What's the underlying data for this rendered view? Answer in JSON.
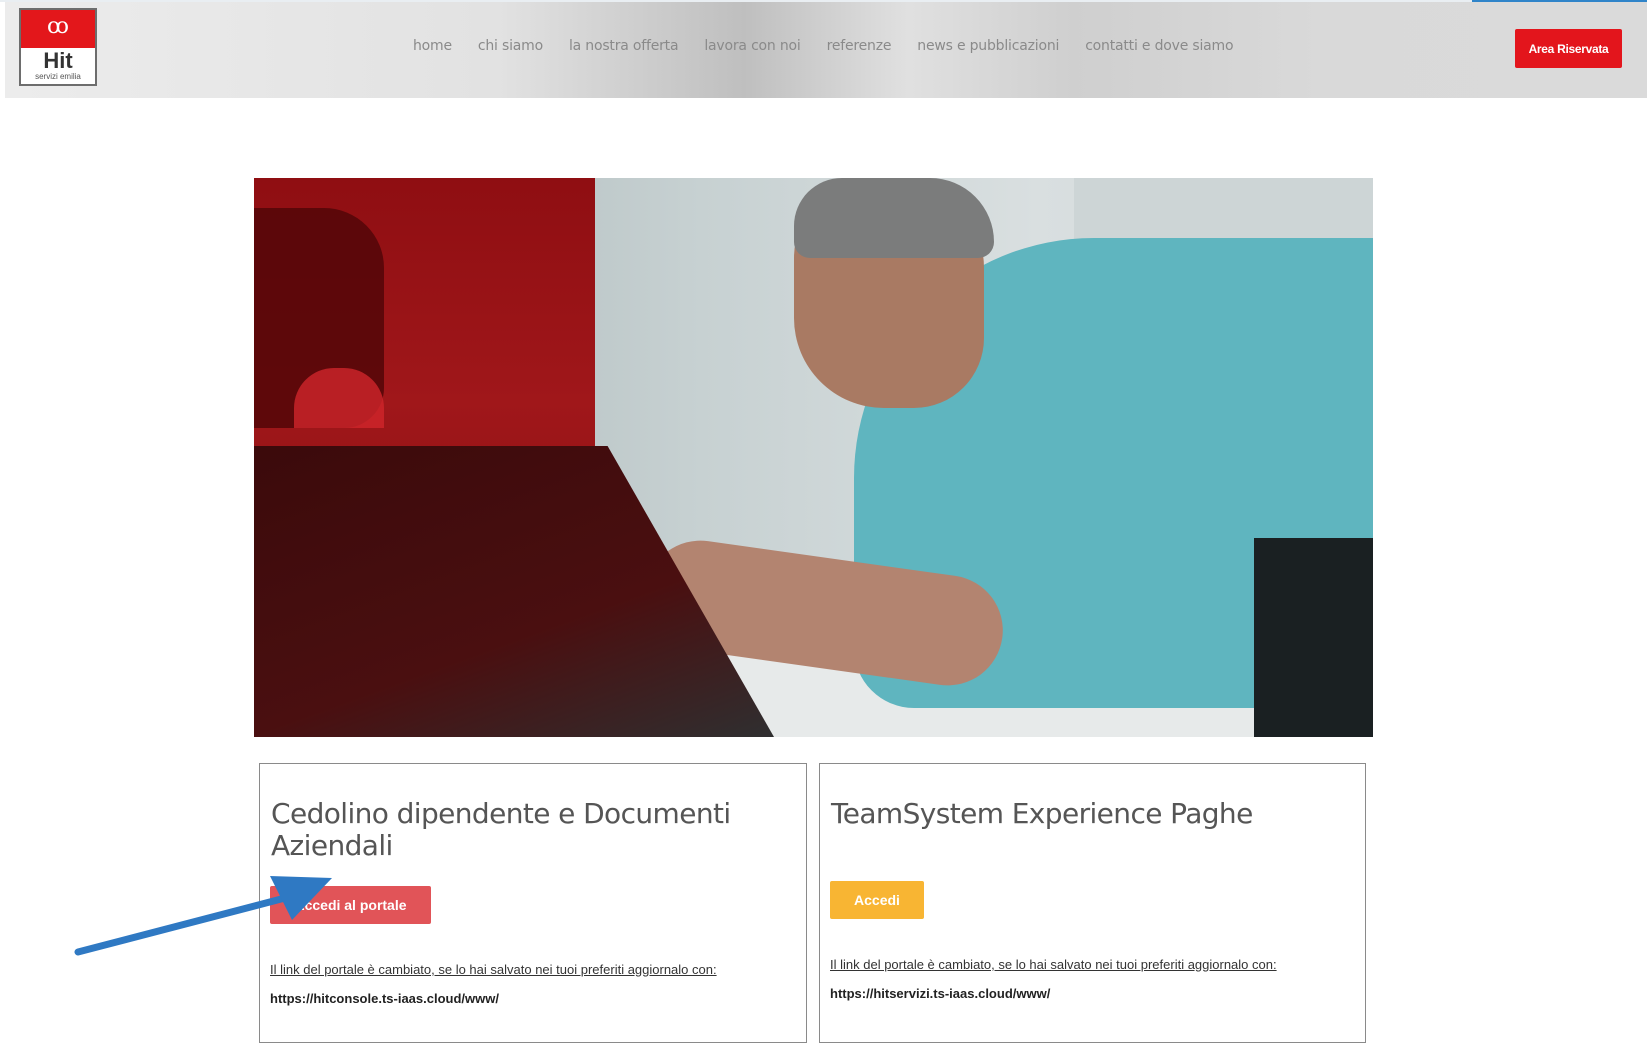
{
  "brand": {
    "logo_name": "Hit",
    "logo_sub": "servizi emilia",
    "logo_glyph": "ꝏ"
  },
  "nav": {
    "items": [
      {
        "label": "home"
      },
      {
        "label": "chi siamo"
      },
      {
        "label": "la nostra offerta"
      },
      {
        "label": "lavora con noi"
      },
      {
        "label": "referenze"
      },
      {
        "label": "news e pubblicazioni"
      },
      {
        "label": "contatti e dove siamo"
      }
    ],
    "area_button": "Area Riservata"
  },
  "colors": {
    "brand_red": "#e3151c",
    "button_red": "#e15458",
    "button_yellow": "#f8b533",
    "annotation_blue": "#2f79c3"
  },
  "cards": [
    {
      "title": "Cedolino dipendente e Documenti Aziendali",
      "button_label": "Accedi al portale",
      "note_text": "Il link del portale è cambiato, se lo hai salvato nei tuoi preferiti aggiornalo con: ",
      "note_url": "https://hitconsole.ts-iaas.cloud/www/"
    },
    {
      "title": "TeamSystem Experience Paghe",
      "button_label": "Accedi",
      "note_text": "Il link del portale è cambiato, se lo hai salvato nei tuoi preferiti aggiornalo con: ",
      "note_url": "https://hitservizi.ts-iaas.cloud/www/"
    }
  ]
}
